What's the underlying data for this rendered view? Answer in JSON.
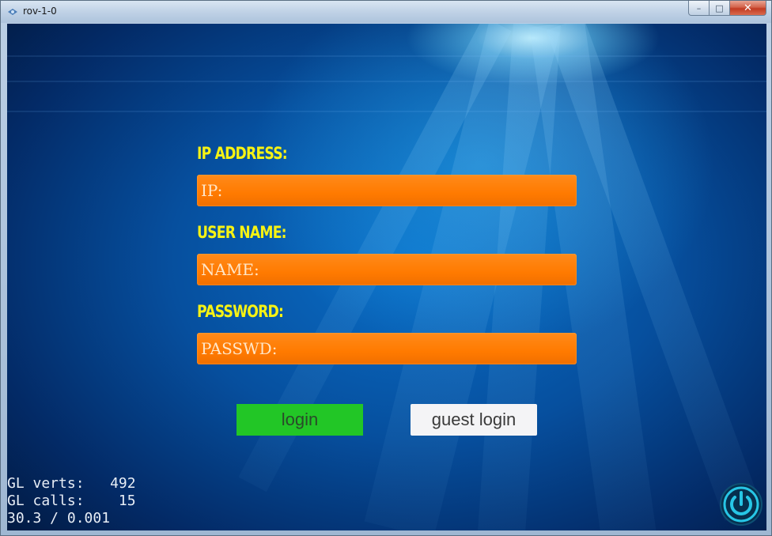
{
  "window": {
    "title": "rov-1-0",
    "controls": {
      "minimize": "–",
      "maximize": "□",
      "close": "✕"
    }
  },
  "form": {
    "ip_label": "IP ADDRESS:",
    "ip_placeholder": "IP:",
    "user_label": "USER NAME:",
    "user_placeholder": "NAME:",
    "password_label": "PASSWORD:",
    "password_placeholder": "PASSWD:"
  },
  "buttons": {
    "login": "login",
    "guest_login": "guest login"
  },
  "stats": {
    "verts_label": "GL verts:",
    "verts_value": "492",
    "calls_label": "GL calls:",
    "calls_value": "15",
    "fps_line": "30.3 / 0.001"
  },
  "icons": {
    "app": "app-icon",
    "power": "power-icon"
  },
  "colors": {
    "label_yellow": "#f6f214",
    "field_orange": "#ff7a00",
    "login_green": "#22c626",
    "guest_white": "#f4f4f6",
    "power_cyan": "#27c6e6"
  }
}
